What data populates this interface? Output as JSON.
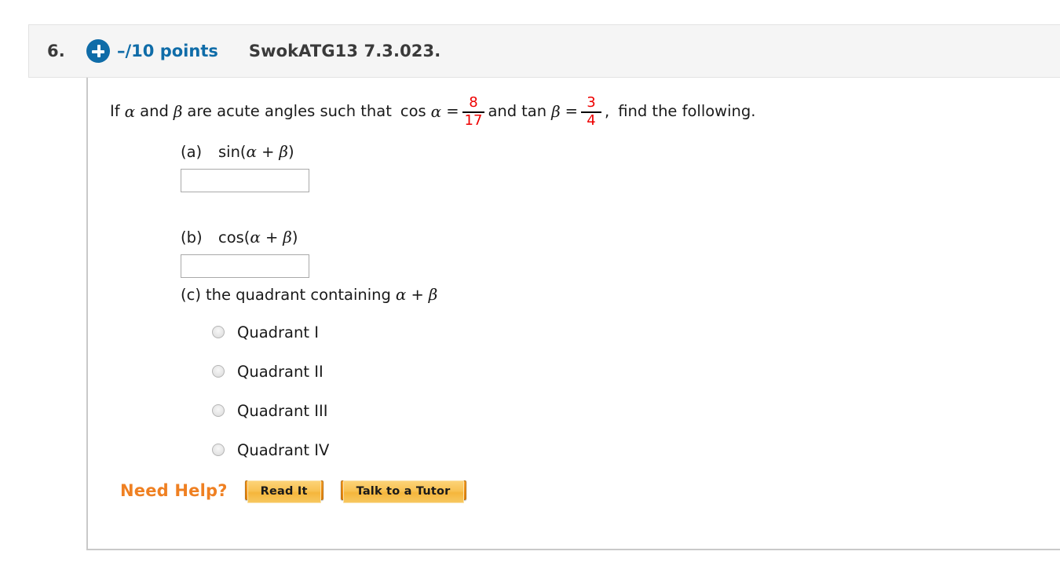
{
  "header": {
    "question_number": "6.",
    "plus_icon": "plus-circle-icon",
    "points": "–/10 points",
    "question_code": "SwokATG13 7.3.023.",
    "accent_blue": "#0f6ca8",
    "background": "#f5f5f5"
  },
  "prompt": {
    "text_1": "If",
    "alpha": "α",
    "text_2": "and",
    "beta": "β",
    "text_3": "are acute angles such that",
    "cos_label": "cos",
    "alpha_2": "α",
    "equals_1": "=",
    "fraction_1": {
      "numerator": "8",
      "denominator": "17",
      "color": "#ee0000"
    },
    "text_4": "and",
    "tan_label": "tan",
    "beta_2": "β",
    "equals_2": "=",
    "fraction_2": {
      "numerator": "3",
      "denominator": "4",
      "color": "#ee0000"
    },
    "comma": ",",
    "text_5": "find the following."
  },
  "parts": {
    "a": {
      "tag": "(a)",
      "expression_fn": "sin(",
      "expression_alpha": "α",
      "expression_plus": "+",
      "expression_beta": "β",
      "expression_close": ")",
      "input_value": "",
      "input_placeholder": ""
    },
    "b": {
      "tag": "(b)",
      "expression_fn": "cos(",
      "expression_alpha": "α",
      "expression_plus": "+",
      "expression_beta": "β",
      "expression_close": ")",
      "input_value": "",
      "input_placeholder": ""
    },
    "c": {
      "tag": "(c)",
      "text": "the quadrant containing",
      "alpha": "α",
      "plus": "+",
      "beta": "β",
      "options": [
        {
          "label": "Quadrant I",
          "selected": false
        },
        {
          "label": "Quadrant II",
          "selected": false
        },
        {
          "label": "Quadrant III",
          "selected": false
        },
        {
          "label": "Quadrant IV",
          "selected": false
        }
      ]
    }
  },
  "need_help": {
    "label": "Need Help?",
    "label_color": "#ef8022",
    "buttons": [
      {
        "label": "Read It"
      },
      {
        "label": "Talk to a Tutor"
      }
    ]
  }
}
